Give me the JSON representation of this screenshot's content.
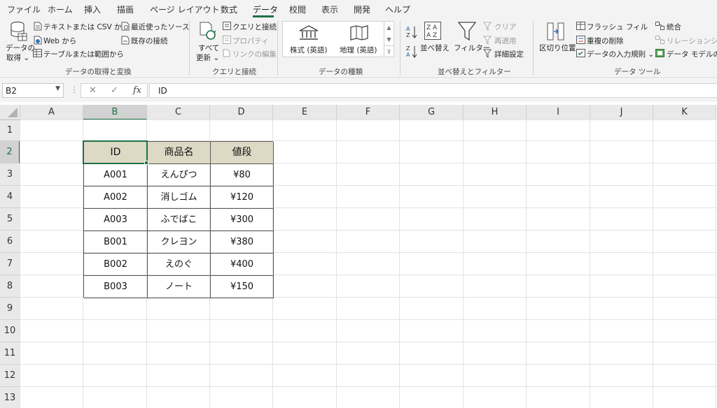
{
  "tabs": [
    "ファイル",
    "ホーム",
    "挿入",
    "描画",
    "ページ レイアウト",
    "数式",
    "データ",
    "校閲",
    "表示",
    "開発",
    "ヘルプ"
  ],
  "active_tab": "データ",
  "ribbon": {
    "get_data": {
      "big_button": [
        "データの",
        "取得 ⌄"
      ],
      "text_csv": "テキストまたは CSV から",
      "web": "Web から",
      "table_range": "テーブルまたは範囲から",
      "recent_sources": "最近使ったソース",
      "existing_connections": "既存の接続",
      "group_label": "データの取得と変換"
    },
    "queries": {
      "refresh_all": [
        "すべて",
        "更新 ⌄"
      ],
      "queries_connections": "クエリと接続",
      "properties": "プロパティ",
      "edit_links": "リンクの編集",
      "group_label": "クエリと接続"
    },
    "data_types": {
      "stocks": "株式 (英語)",
      "geography": "地理 (英語)",
      "group_label": "データの種類"
    },
    "sort_filter": {
      "sort": "並べ替え",
      "filter": "フィルター",
      "clear": "クリア",
      "reapply": "再適用",
      "advanced": "詳細設定",
      "group_label": "並べ替えとフィルター"
    },
    "data_tools": {
      "text_to_columns": "区切り位置",
      "flash_fill": "フラッシュ フィル",
      "remove_duplicates": "重複の削除",
      "data_validation": "データの入力規則 ⌄",
      "consolidate": "統合",
      "relationships": "リレーションシップ",
      "data_model": "データ モデルの管",
      "group_label": "データ ツール"
    }
  },
  "formula_bar": {
    "name_box": "B2",
    "fx": "fx",
    "cancel": "✕",
    "enter": "✓",
    "content": "ID"
  },
  "columns": [
    "A",
    "B",
    "C",
    "D",
    "E",
    "F",
    "G",
    "H",
    "I",
    "J",
    "K"
  ],
  "rows": [
    "1",
    "2",
    "3",
    "4",
    "5",
    "6",
    "7",
    "8",
    "9",
    "10",
    "11",
    "12",
    "13"
  ],
  "selected_column": "B",
  "selected_row": "2",
  "table": {
    "header": [
      "ID",
      "商品名",
      "値段"
    ],
    "rows": [
      [
        "A001",
        "えんぴつ",
        "¥80"
      ],
      [
        "A002",
        "消しゴム",
        "¥120"
      ],
      [
        "A003",
        "ふでばこ",
        "¥300"
      ],
      [
        "B001",
        "クレヨン",
        "¥380"
      ],
      [
        "B002",
        "えのぐ",
        "¥400"
      ],
      [
        "B003",
        "ノート",
        "¥150"
      ]
    ],
    "header_color": "#ddd9c4"
  },
  "accent_color": "#1e7145"
}
